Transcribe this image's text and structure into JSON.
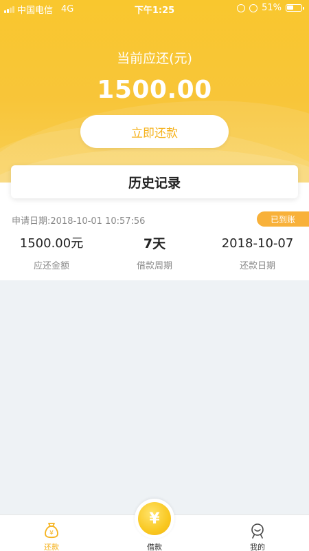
{
  "statusbar": {
    "carrier": "中国电信",
    "network": "4G",
    "time": "下午1:25",
    "battery": "51%",
    "battery_level": 0.51
  },
  "header": {
    "due_label": "当前应还(元)",
    "due_amount": "1500.00",
    "repay_button": "立即还款"
  },
  "history": {
    "title": "历史记录"
  },
  "record": {
    "apply_date": "申请日期:2018-10-01 10:57:56",
    "status": "已到账",
    "amount": "1500.00元",
    "amount_label": "应还金额",
    "period": "7天",
    "period_label": "借款周期",
    "due_date": "2018-10-07",
    "due_date_label": "还款日期"
  },
  "tabbar": {
    "items": [
      {
        "label": "还款",
        "icon": "money-bag-icon",
        "active": true
      },
      {
        "label": "借款",
        "icon": "yuan-coin-icon",
        "active": false
      },
      {
        "label": "我的",
        "icon": "profile-icon",
        "active": false
      }
    ],
    "borrow_symbol": "¥"
  },
  "colors": {
    "brand_yellow": "#f9c72e",
    "accent_orange": "#f8b13a",
    "button_text": "#f5b21d",
    "page_bg": "#eef2f5"
  }
}
